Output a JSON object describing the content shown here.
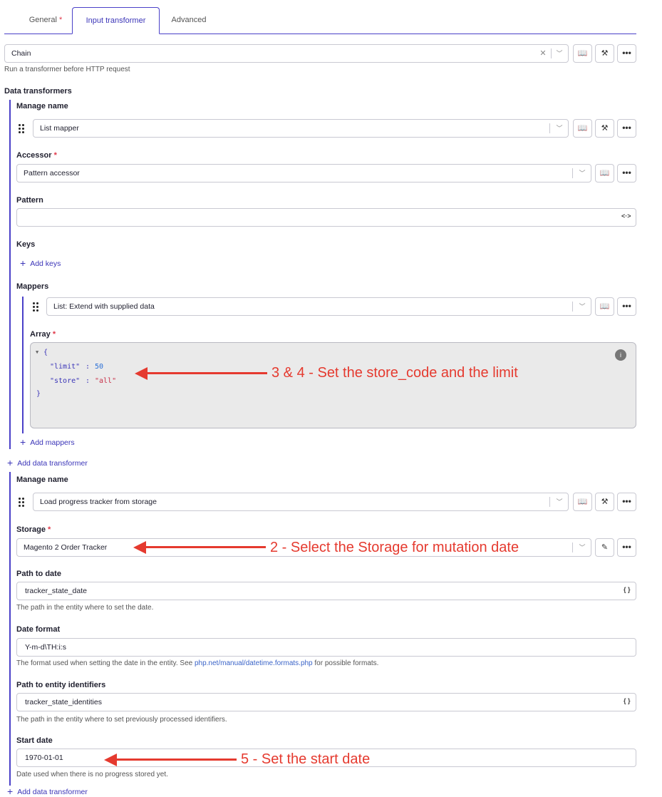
{
  "tabs": [
    {
      "label": "General",
      "required": "*"
    },
    {
      "label": "Input transformer"
    },
    {
      "label": "Advanced"
    }
  ],
  "chain": {
    "value": "Chain",
    "help": "Run a transformer before HTTP request"
  },
  "data_transformers": {
    "label": "Data transformers",
    "t1": {
      "manage_label": "Manage name",
      "manage_value": "List mapper",
      "accessor_label": "Accessor",
      "accessor_value": "Pattern accessor",
      "pattern_label": "Pattern",
      "keys_label": "Keys",
      "add_keys": "Add keys",
      "mappers_label": "Mappers",
      "mapper_value": "List: Extend with supplied data",
      "array_label": "Array",
      "array_lines": [
        "{",
        "\"limit\"",
        " : ",
        "50",
        "\"store\"",
        " : ",
        "\"all\"",
        "}"
      ],
      "add_mappers": "Add mappers"
    },
    "add_data_transformer": "Add data transformer",
    "t2": {
      "manage_label": "Manage name",
      "manage_value": "Load progress tracker from storage",
      "storage_label": "Storage",
      "storage_value": "Magento 2 Order Tracker",
      "path_date_label": "Path to date",
      "path_date_value": "tracker_state_date",
      "path_date_help": "The path in the entity where to set the date.",
      "date_format_label": "Date format",
      "date_format_value": "Y-m-d\\TH:i:s",
      "date_format_help_pre": "The format used when setting the date in the entity. See ",
      "date_format_help_link": "php.net/manual/datetime.formats.php",
      "date_format_help_post": " for possible formats.",
      "path_ids_label": "Path to entity identifiers",
      "path_ids_value": "tracker_state_identities",
      "path_ids_help": "The path in the entity where to set previously processed identifiers.",
      "start_date_label": "Start date",
      "start_date_value": "1970-01-01",
      "start_date_help": "Date used when there is no progress stored yet."
    },
    "add_data_transformer_2": "Add data transformer"
  },
  "required_mark": "*",
  "annotations": {
    "a1": "3 & 4 - Set the store_code and the limit",
    "a2": "2 - Select the Storage for mutation date",
    "a3": "5 - Set the start date"
  },
  "colors": {
    "accent": "#4a40c8",
    "annotation": "#e53a2f",
    "required": "#e0394a"
  }
}
